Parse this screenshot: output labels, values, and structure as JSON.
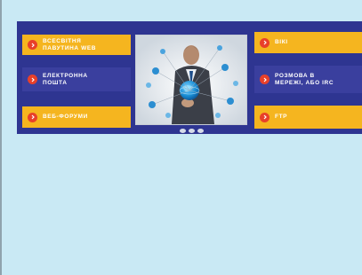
{
  "menu": {
    "left": [
      {
        "label": "Всесвітня\nпавутина WEB",
        "style": "yellow"
      },
      {
        "label": "Електронна\nпошта",
        "style": "blue"
      },
      {
        "label": "Веб-форуми",
        "style": "yellow"
      }
    ],
    "right": [
      {
        "label": "Вікі",
        "style": "yellow"
      },
      {
        "label": "Розмова в\nмережі, або IRC",
        "style": "blue"
      },
      {
        "label": "FTP",
        "style": "yellow"
      }
    ]
  },
  "colors": {
    "page_background": "#c9e9f4",
    "banner": "#2e3591",
    "tile_yellow": "#f5b51f",
    "tile_blue": "#3a3f9e",
    "arrow": "#e8402a"
  },
  "icons": {
    "tile_arrow": "chevron-right-icon",
    "photo": "businessman-globe-network-photo"
  }
}
